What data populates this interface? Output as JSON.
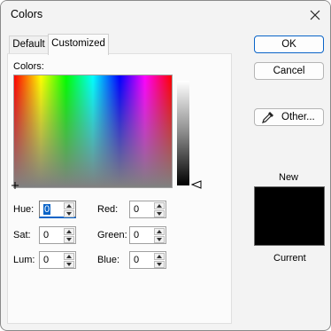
{
  "window": {
    "title": "Colors"
  },
  "tabs": [
    {
      "label": "Default",
      "active": false
    },
    {
      "label": "Customized",
      "active": true
    }
  ],
  "colors_label": "Colors:",
  "fields": {
    "hue": {
      "label": "Hue:",
      "value": "0"
    },
    "sat": {
      "label": "Sat:",
      "value": "0"
    },
    "lum": {
      "label": "Lum:",
      "value": "0"
    },
    "red": {
      "label": "Red:",
      "value": "0"
    },
    "green": {
      "label": "Green:",
      "value": "0"
    },
    "blue": {
      "label": "Blue:",
      "value": "0"
    }
  },
  "buttons": {
    "ok": "OK",
    "cancel": "Cancel",
    "other": "Other..."
  },
  "preview": {
    "new_label": "New",
    "current_label": "Current",
    "color": "#000000"
  },
  "colors": {
    "accent": "#0a64c8"
  }
}
